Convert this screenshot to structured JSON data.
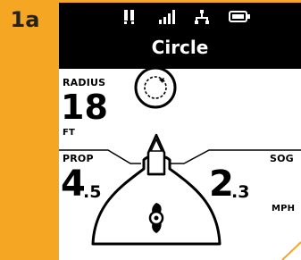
{
  "figure_label": "1a",
  "mode_title": "Circle",
  "status_icons": [
    "pause-icon",
    "signal-bars-icon",
    "network-icon",
    "battery-icon"
  ],
  "radius": {
    "label": "RADIUS",
    "value": "18",
    "unit": "FT"
  },
  "prop": {
    "label": "PROP",
    "value_main": "4",
    "value_decimal": ".5"
  },
  "sog": {
    "label": "SOG",
    "value_main": "2",
    "value_decimal": ".3",
    "unit": "MPH"
  },
  "colors": {
    "frame": "#f5a623",
    "bar": "#000000",
    "screen": "#ffffff"
  }
}
